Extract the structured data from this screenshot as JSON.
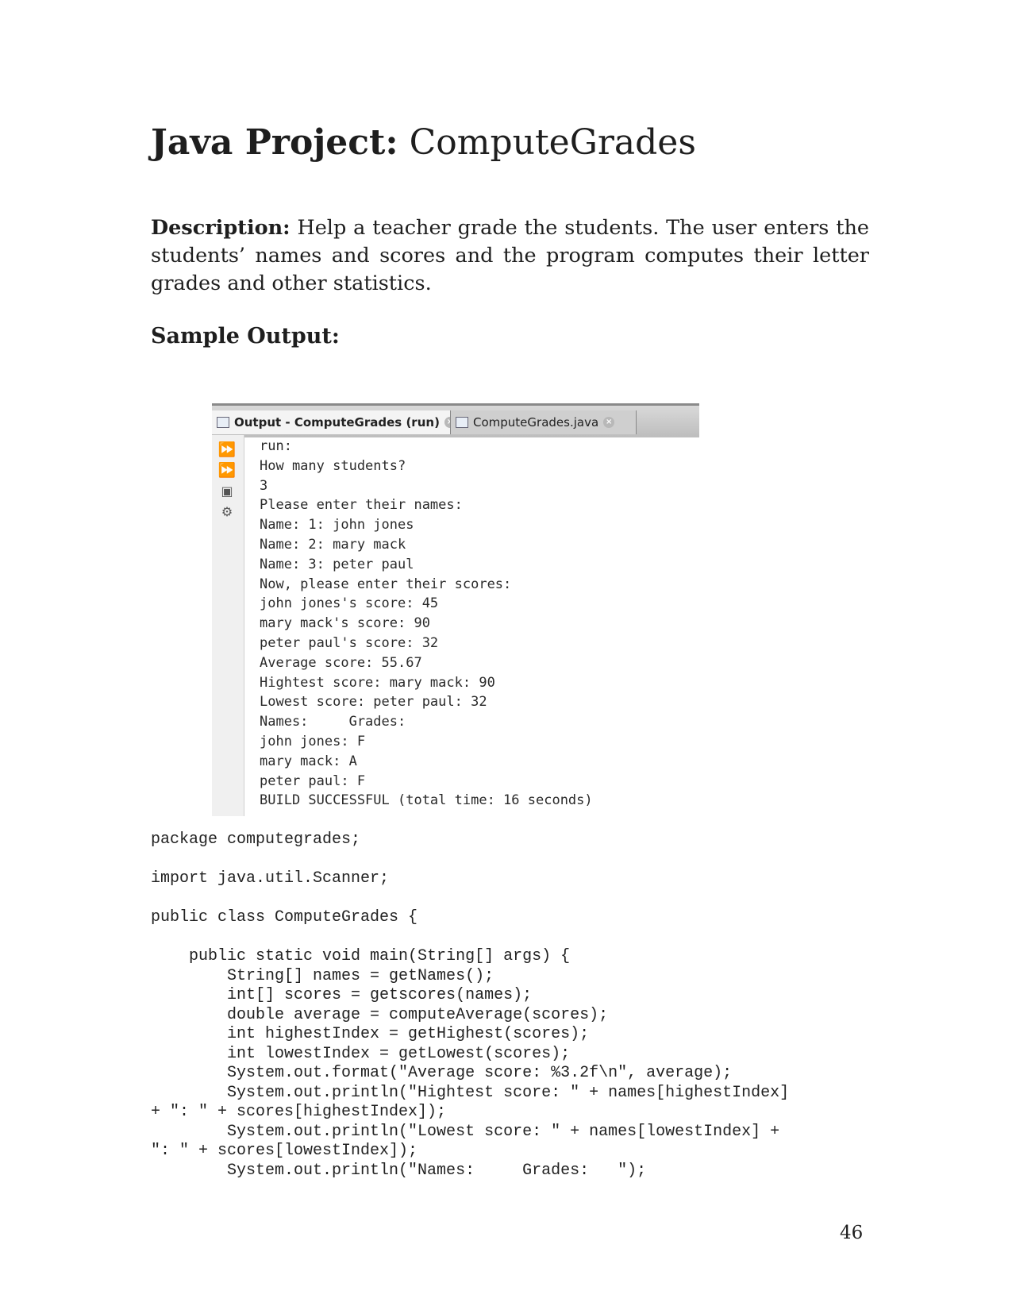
{
  "title": {
    "bold": "Java Project:",
    "rest": " ComputeGrades"
  },
  "description": {
    "label": "Description:",
    "text": " Help a teacher grade the students.  The user enters the students’ names and scores and the program computes their letter grades and other statistics."
  },
  "sample_heading": "Sample Output:",
  "ide": {
    "output_tab": "Output - ComputeGrades (run)",
    "file_tab": "ComputeGrades.java",
    "gutter_icons": [
      "rerun-icon",
      "rerun-with-options-icon",
      "stop-icon",
      "settings-icon"
    ],
    "console_lines": [
      "run:",
      "How many students?",
      "3",
      "Please enter their names:",
      "Name: 1: john jones",
      "Name: 2: mary mack",
      "Name: 3: peter paul",
      "Now, please enter their scores:",
      "john jones's score: 45",
      "mary mack's score: 90",
      "peter paul's score: 32",
      "Average score: 55.67",
      "Hightest score: mary mack: 90",
      "Lowest score: peter paul: 32",
      "Names:     Grades:",
      "john jones: F",
      "mary mack: A",
      "peter paul: F",
      "BUILD SUCCESSFUL (total time: 16 seconds)"
    ]
  },
  "code_lines": [
    "package computegrades;",
    "",
    "import java.util.Scanner;",
    "",
    "public class ComputeGrades {",
    "",
    "    public static void main(String[] args) {",
    "        String[] names = getNames();",
    "        int[] scores = getscores(names);",
    "        double average = computeAverage(scores);",
    "        int highestIndex = getHighest(scores);",
    "        int lowestIndex = getLowest(scores);",
    "        System.out.format(\"Average score: %3.2f\\n\", average);",
    "        System.out.println(\"Hightest score: \" + names[highestIndex]",
    "+ \": \" + scores[highestIndex]);",
    "        System.out.println(\"Lowest score: \" + names[lowestIndex] +",
    "\": \" + scores[lowestIndex]);",
    "        System.out.println(\"Names:     Grades:   \");"
  ],
  "page_number": "46"
}
